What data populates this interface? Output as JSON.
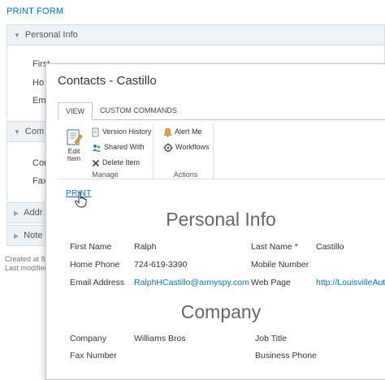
{
  "background": {
    "form_title": "PRINT FORM",
    "sections": [
      {
        "label": "Personal Info",
        "expanded": true
      },
      {
        "label": "Com",
        "expanded": true
      },
      {
        "label": "Addr",
        "expanded": false
      },
      {
        "label": "Note",
        "expanded": false
      }
    ],
    "partial_labels": [
      "First",
      "Ho",
      "Em",
      "Cou",
      "Fax"
    ],
    "footer": [
      "Created at 8/",
      "Last modified"
    ]
  },
  "modal": {
    "title": "Contacts - Castillo",
    "tabs": [
      "VIEW",
      "CUSTOM COMMANDS"
    ],
    "ribbon": {
      "manage": {
        "label": "Manage",
        "edit_item": "Edit Item",
        "version_history": "Version History",
        "shared_with": "Shared With",
        "delete_item": "Delete Item"
      },
      "actions": {
        "label": "Actions",
        "alert_me": "Alert Me",
        "workflows": "Workflows"
      }
    },
    "print_link": "PRINT",
    "personal_info": {
      "heading": "Personal Info",
      "first_name_label": "First Name",
      "first_name": "Ralph",
      "last_name_label": "Last Name",
      "required_marker": "*",
      "last_name": "Castillo",
      "home_phone_label": "Home Phone",
      "home_phone": "724-619-3390",
      "mobile_label": "Mobile Number",
      "email_label": "Email Address",
      "email": "RalphHCastillo@armyspy.com",
      "web_page_label": "Web Page",
      "web_page": "http://LouisvilleAut"
    },
    "company": {
      "heading": "Company",
      "company_label": "Company",
      "company": "Williams Bros",
      "job_title_label": "Job Title",
      "fax_label": "Fax Number",
      "business_phone_label": "Business Phone"
    }
  },
  "colors": {
    "link": "#0072c6",
    "section_bg": "#eef3f8",
    "required": "#cc0000"
  }
}
